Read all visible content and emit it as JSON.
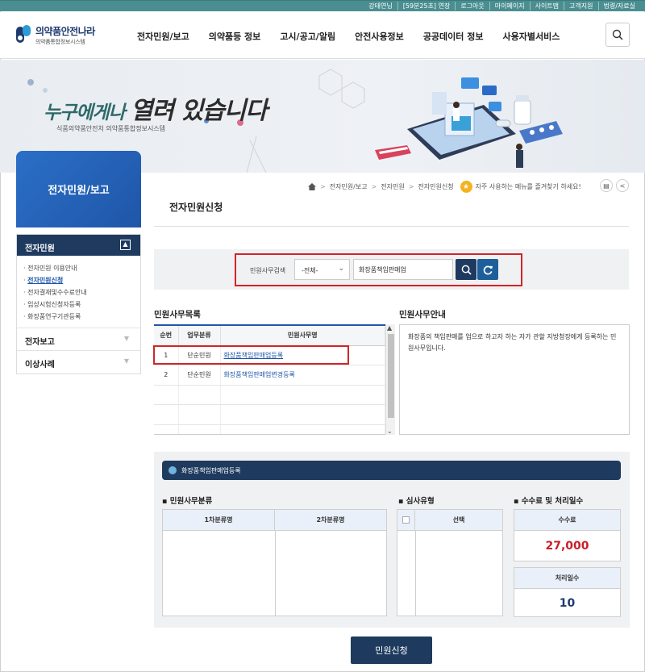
{
  "util": {
    "items": [
      "강태연님",
      "[59분25초] 연장",
      "로그아웃",
      "마이페이지",
      "사이트맵",
      "고객지원",
      "법령/자료실"
    ]
  },
  "header": {
    "logo_title": "의약품안전나라",
    "logo_sub": "의약품통합정보시스템",
    "nav": [
      "전자민원/보고",
      "의약품등 정보",
      "고시/공고/알림",
      "안전사용정보",
      "공공데이터 정보",
      "사용자별서비스"
    ]
  },
  "banner": {
    "slogan_a": "누구에게나",
    "slogan_b": "열려 있습니다",
    "sub": "식품의약품안전처 의약품통합정보시스템"
  },
  "sidebar": {
    "title": "전자민원/보고",
    "head": "전자민원",
    "sub_items": [
      "전자민원 이용안내",
      "전자민원신청",
      "전자결재및수수료안내",
      "임상시험신청자등록",
      "화장품연구기관등록"
    ],
    "active_index": 1,
    "items": [
      "전자보고",
      "이상사례"
    ]
  },
  "breadcrumb": {
    "items": [
      "전자민원/보고",
      "전자민원",
      "전자민원신청"
    ],
    "favorite_text": "자주 사용하는 메뉴를 즐겨찾기 하세요!"
  },
  "page": {
    "title": "전자민원신청"
  },
  "search": {
    "label": "민원사무검색",
    "select_value": "-전체-",
    "input_value": "화장품책임판매업"
  },
  "list": {
    "title": "민원사무목록",
    "headers": [
      "순번",
      "업무분류",
      "민원사무명"
    ],
    "rows": [
      {
        "no": "1",
        "category": "단순민원",
        "name": "화장품책임판매업등록"
      },
      {
        "no": "2",
        "category": "단순민원",
        "name": "화장품책임판매업변경등록"
      }
    ]
  },
  "guide": {
    "title": "민원사무안내",
    "text": "화장품의 책임판매를 업으로 하고자 하는 자가 관할 지방청장에게 등록하는 민원사무입니다."
  },
  "detail": {
    "bar_title": "화장품책임판매업등록",
    "class_title": "민원사무분류",
    "class_headers": [
      "1차분류명",
      "2차분류명"
    ],
    "review_title": "심사유형",
    "review_header": "선택",
    "fee_title": "수수료 및 처리일수",
    "fee_label": "수수료",
    "fee_value": "27,000",
    "days_label": "처리일수",
    "days_value": "10"
  },
  "submit_label": "민원신청",
  "colors": {
    "accent_red": "#d0252a",
    "navy": "#1e3b5f",
    "blue": "#1f56a8",
    "fee_red": "#c8202a",
    "days_blue": "#1f3a6e"
  }
}
